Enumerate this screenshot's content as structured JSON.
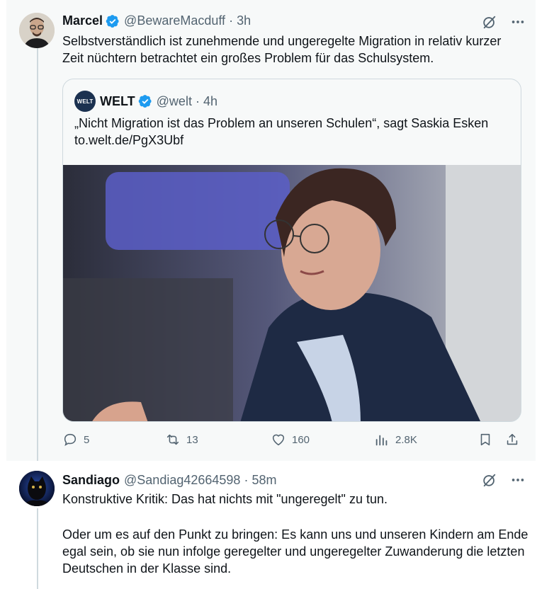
{
  "tweet1": {
    "name": "Marcel",
    "handle": "@BewareMacduff",
    "separator": "·",
    "time": "3h",
    "text": "Selbstverständlich ist zunehmende und ungeregelte Migration in relativ kurzer Zeit nüchtern betrachtet ein großes Problem für das Schulsystem.",
    "quote": {
      "logo_text": "WELT",
      "name": "WELT",
      "handle": "@welt",
      "separator": "·",
      "time": "4h",
      "text": "„Nicht Migration ist das Problem an unseren Schulen“, sagt Saskia Esken to.welt.de/PgX3Ubf"
    },
    "actions": {
      "replies": "5",
      "retweets": "13",
      "likes": "160",
      "views": "2.8K"
    }
  },
  "tweet2": {
    "name": "Sandiago",
    "handle": "@Sandiag42664598",
    "separator": "·",
    "time": "58m",
    "text_p1": "Konstruktive Kritik: Das hat nichts mit \"ungeregelt\" zu tun.",
    "text_p2": "Oder um es auf den Punkt zu bringen: Es kann uns und unseren Kindern am Ende egal sein, ob sie nun infolge geregelter und ungeregelter Zuwanderung die letzten Deutschen in der Klasse sind."
  },
  "colors": {
    "verified": "#1d9bf0",
    "muted": "#536471",
    "border": "#cfd9de"
  }
}
